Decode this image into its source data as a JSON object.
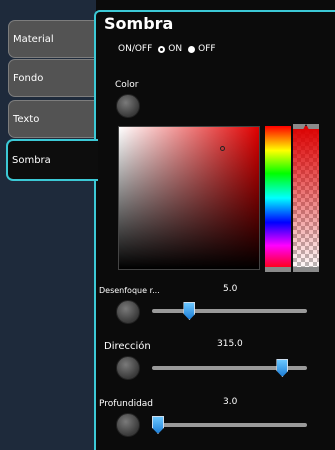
{
  "sidebar": {
    "tabs": [
      {
        "label": "Material"
      },
      {
        "label": "Fondo"
      },
      {
        "label": "Texto"
      },
      {
        "label": "Sombra"
      }
    ]
  },
  "panel": {
    "title": "Sombra",
    "onoff_label": "ON/OFF",
    "on_label": "ON",
    "off_label": "OFF",
    "color_label": "Color"
  },
  "sliders": [
    {
      "label": "Desenfoque r...",
      "value": "5.0",
      "fraction": 0.22
    },
    {
      "label": "Dirección",
      "value": "315.0",
      "fraction": 0.87
    },
    {
      "label": "Profundidad",
      "value": "3.0",
      "fraction": 0.0
    }
  ],
  "colors": {
    "accent": "#3cc9d6",
    "tab_inactive": "#535353",
    "sidebar_bg": "#1e2a3b",
    "selected_color": "#e00000"
  }
}
